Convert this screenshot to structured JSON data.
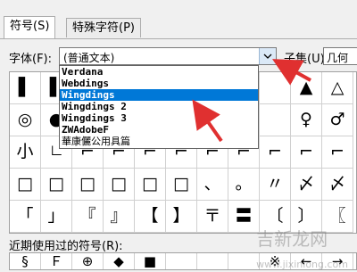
{
  "tabs": [
    {
      "label": "符号(S)"
    },
    {
      "label": "特殊字符(P)"
    }
  ],
  "font": {
    "label": "字体(F):",
    "value": "(普通文本)",
    "options": [
      "Verdana",
      "Webdings",
      "Wingdings",
      "Wingdings 2",
      "Wingdings 3",
      "ZWAdobeF",
      "華康儷公用具篇"
    ],
    "selected": "Wingdings"
  },
  "subset": {
    "label": "子集(U):",
    "value": "几何"
  },
  "grid": {
    "rows": [
      [
        "▌",
        "▌",
        "",
        "",
        "",
        "",
        "",
        "",
        "",
        "▲",
        "△"
      ],
      [
        "◎",
        "●",
        "",
        "",
        "",
        "",
        "",
        "",
        "",
        "♀",
        "♂"
      ],
      [
        "小",
        "𠃊",
        "⌐",
        "⌐",
        "⌐",
        "⌐",
        "⌐",
        "⌐",
        "⌐",
        "⌐",
        "⌐"
      ],
      [
        "□",
        "□",
        "□",
        "□",
        "□",
        "□",
        "、",
        "。",
        "〃",
        "〆",
        "〆"
      ],
      [
        "「",
        "」",
        "『",
        "』",
        "【",
        "】",
        "〒",
        "〓",
        "〔",
        "〕",
        "〖"
      ]
    ]
  },
  "recent": {
    "label": "近期使用过的符号(R):",
    "symbols": [
      "§",
      "Ｆ",
      "⊕",
      "◆",
      "■",
      "",
      "",
      "",
      "※",
      "←",
      "→"
    ]
  },
  "watermark": {
    "text": "吉新龙网",
    "domain": "www.jixinlong.com"
  },
  "colors": {
    "selection": "#0078d7",
    "arrow": "#e03030"
  }
}
